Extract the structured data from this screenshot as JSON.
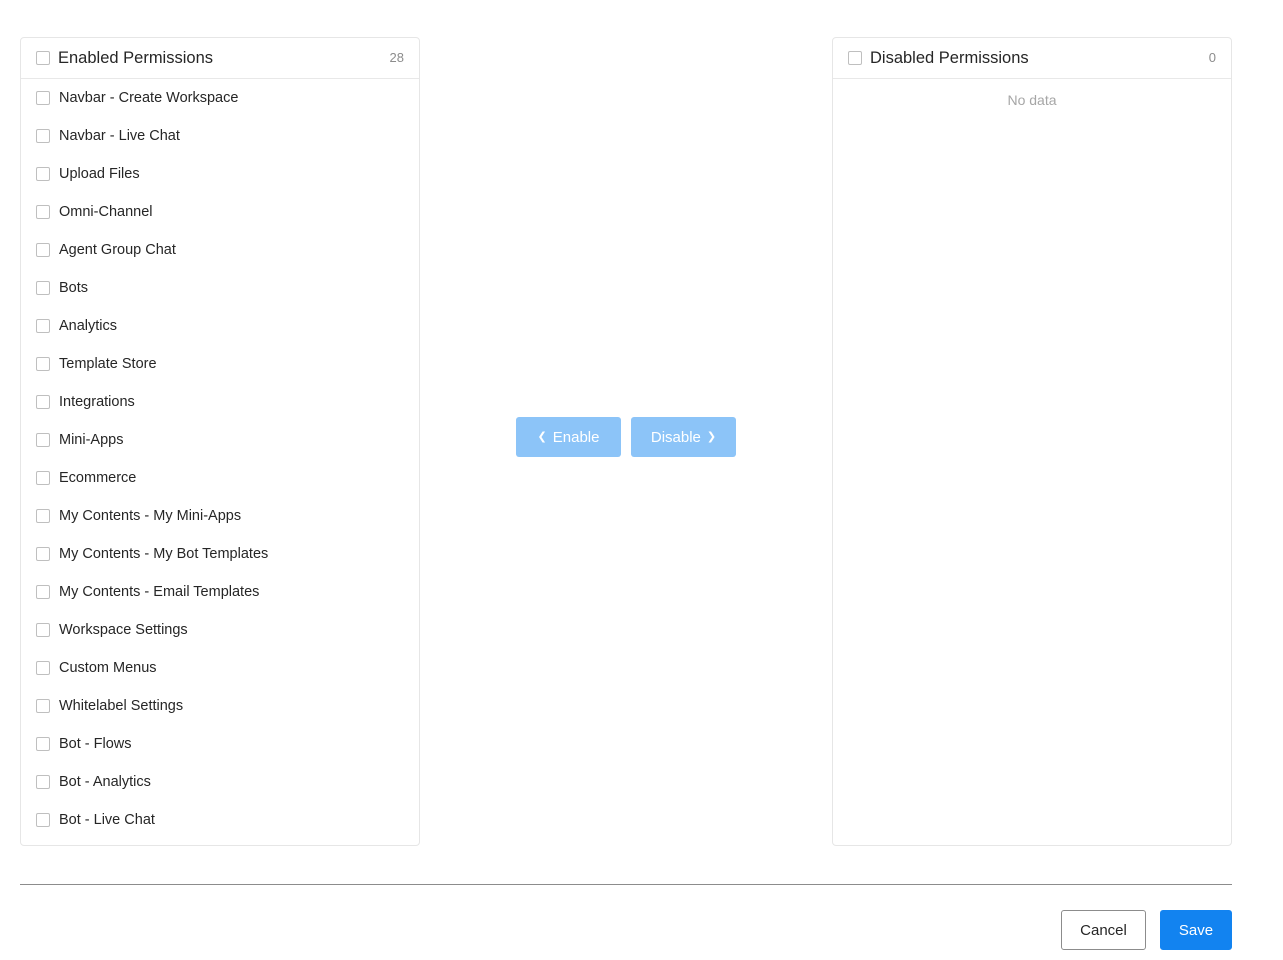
{
  "enabled_panel": {
    "title": "Enabled Permissions",
    "count": "28",
    "items": [
      {
        "label": "Navbar - Create Workspace"
      },
      {
        "label": "Navbar - Live Chat"
      },
      {
        "label": "Upload Files"
      },
      {
        "label": "Omni-Channel"
      },
      {
        "label": "Agent Group Chat"
      },
      {
        "label": "Bots"
      },
      {
        "label": "Analytics"
      },
      {
        "label": "Template Store"
      },
      {
        "label": "Integrations"
      },
      {
        "label": "Mini-Apps"
      },
      {
        "label": "Ecommerce"
      },
      {
        "label": "My Contents - My Mini-Apps"
      },
      {
        "label": "My Contents - My Bot Templates"
      },
      {
        "label": "My Contents - Email Templates"
      },
      {
        "label": "Workspace Settings"
      },
      {
        "label": "Custom Menus"
      },
      {
        "label": "Whitelabel Settings"
      },
      {
        "label": "Bot - Flows"
      },
      {
        "label": "Bot - Analytics"
      },
      {
        "label": "Bot - Live Chat"
      }
    ]
  },
  "disabled_panel": {
    "title": "Disabled Permissions",
    "count": "0",
    "empty_text": "No data"
  },
  "transfer": {
    "enable_label": "Enable",
    "disable_label": "Disable"
  },
  "footer": {
    "cancel_label": "Cancel",
    "save_label": "Save"
  },
  "colors": {
    "primary": "#1283f0",
    "primary_disabled": "#8cc4f8",
    "border": "#e6e6e6",
    "text": "#262626",
    "muted": "#8c8c8c"
  },
  "icons": {
    "enable": "chevron-left-icon",
    "disable": "chevron-right-icon"
  }
}
